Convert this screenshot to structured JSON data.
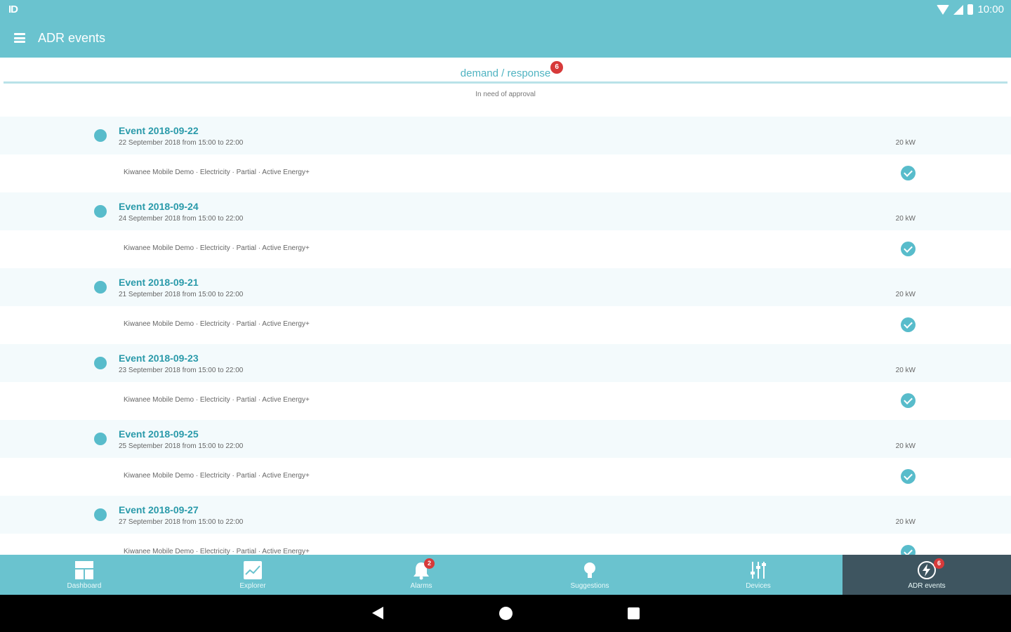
{
  "status_bar": {
    "left_icon": "ID",
    "time": "10:00"
  },
  "app_bar": {
    "title": "ADR events"
  },
  "tab": {
    "label": "demand / response",
    "badge": "6",
    "subtitle": "In need of approval"
  },
  "events": [
    {
      "title": "Event 2018-09-22",
      "date": "22 September 2018 from 15:00 to 22:00",
      "power": "20 kW",
      "detail": "Kiwanee Mobile Demo · Electricity · Partial · Active Energy+"
    },
    {
      "title": "Event 2018-09-24",
      "date": "24 September 2018 from 15:00 to 22:00",
      "power": "20 kW",
      "detail": "Kiwanee Mobile Demo · Electricity · Partial · Active Energy+"
    },
    {
      "title": "Event 2018-09-21",
      "date": "21 September 2018 from 15:00 to 22:00",
      "power": "20 kW",
      "detail": "Kiwanee Mobile Demo · Electricity · Partial · Active Energy+"
    },
    {
      "title": "Event 2018-09-23",
      "date": "23 September 2018 from 15:00 to 22:00",
      "power": "20 kW",
      "detail": "Kiwanee Mobile Demo · Electricity · Partial · Active Energy+"
    },
    {
      "title": "Event 2018-09-25",
      "date": "25 September 2018 from 15:00 to 22:00",
      "power": "20 kW",
      "detail": "Kiwanee Mobile Demo · Electricity · Partial · Active Energy+"
    },
    {
      "title": "Event 2018-09-27",
      "date": "27 September 2018 from 15:00 to 22:00",
      "power": "20 kW",
      "detail": "Kiwanee Mobile Demo · Electricity · Partial · Active Energy+"
    }
  ],
  "bottom_nav": [
    {
      "label": "Dashboard",
      "icon": "dashboard-icon"
    },
    {
      "label": "Explorer",
      "icon": "explorer-icon"
    },
    {
      "label": "Alarms",
      "icon": "bell-icon",
      "badge": "2"
    },
    {
      "label": "Suggestions",
      "icon": "lightbulb-icon"
    },
    {
      "label": "Devices",
      "icon": "sliders-icon"
    },
    {
      "label": "ADR events",
      "icon": "lightning-icon",
      "badge": "6",
      "active": true
    }
  ],
  "colors": {
    "primary": "#6ac3cf",
    "accent": "#4fb3c1",
    "active_nav": "#3e5560",
    "badge": "#d73a3a"
  }
}
